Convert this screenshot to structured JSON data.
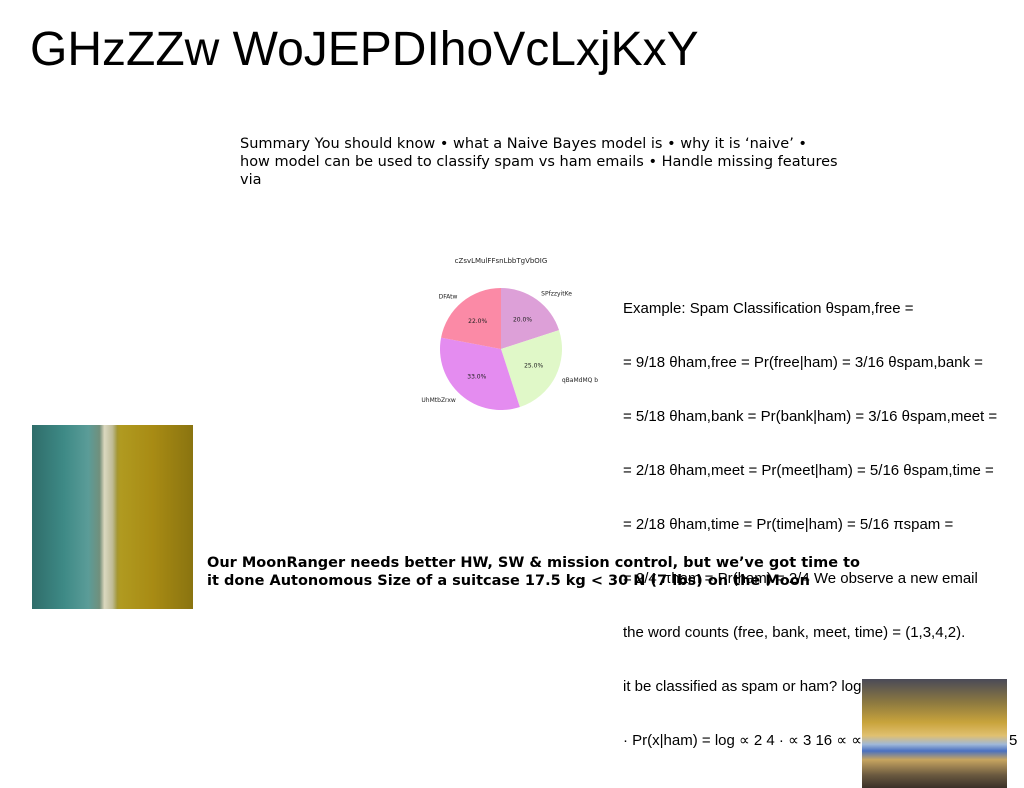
{
  "title": "GHzZZw WoJEPDIhoVcLxjKxY",
  "summary": "Summary You should know • what a Naive Bayes model is • why it is ‘naive’ • how model can be used to classify spam vs ham emails • Handle missing features via",
  "example_lines": [
    "Example: Spam Classification θspam,free =",
    "= 9/18 θham,free = Pr(free|ham) = 3/16 θspam,bank =",
    "= 5/18 θham,bank = Pr(bank|ham) = 3/16 θspam,meet =",
    "= 2/18 θham,meet = Pr(meet|ham) = 5/16 θspam,time =",
    "= 2/18 θham,time = Pr(time|ham) = 5/16 πspam =",
    "= 2/4 πham = Pr(ham) = 2/4 We observe a new email",
    "the word counts (free, bank, meet, time) = (1,3,4,2).",
    "it be classified as spam or ham? log Pr(ham|x) ∝ log",
    "· Pr(x|ham) = log ∝ 2 4 · ∝ 3 16 ∝ ∝ 3 16 ∝3 ∝ 5 16 ∝4 ∝ 5"
  ],
  "moon_text": "Our MoonRanger needs better HW, SW & mission control, but we’ve got time to it done Autonomous Size of a suitcase 17.5 kg < 30 N (7 lbs) on the Moon",
  "chart_data": {
    "type": "pie",
    "title": "cZsvLMulFFsnLbbTgVbOIG",
    "slices": [
      {
        "label": "SPfzzyitKe",
        "value": 20.0,
        "pct_label": "20.0%",
        "color": "#dda0d8"
      },
      {
        "label": "qBaMdMQ b",
        "value": 25.0,
        "pct_label": "25.0%",
        "color": "#e0f8c8"
      },
      {
        "label": "UhMtbZrxw",
        "value": 33.0,
        "pct_label": "33.0%",
        "color": "#e48cf0"
      },
      {
        "label": "DFAtw",
        "value": 22.0,
        "pct_label": "22.0%",
        "color": "#fb8aa6"
      }
    ],
    "start_angle_deg": 90,
    "direction": "clockwise"
  }
}
